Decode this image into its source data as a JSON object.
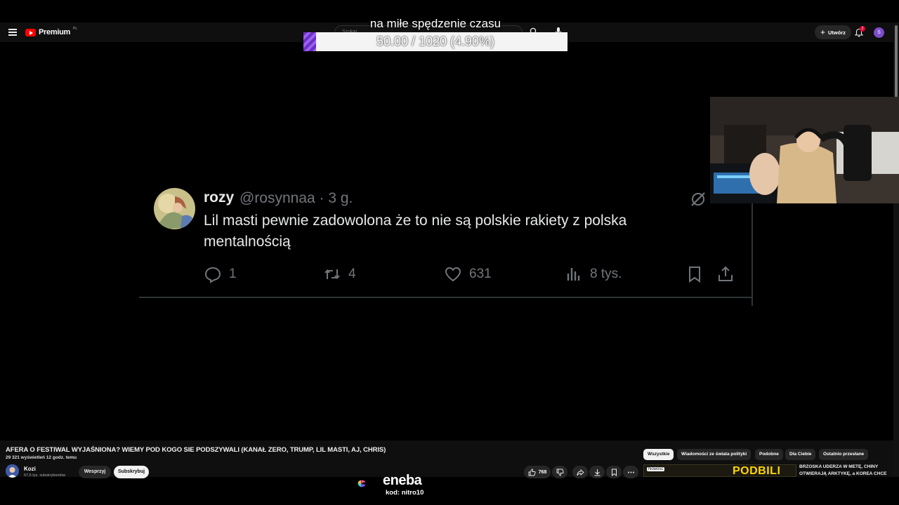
{
  "overlay": {
    "title": "na miłe spędzenie czasu",
    "progress_text": "50.00 / 1020 (4.90%)",
    "progress_fraction": 0.049
  },
  "youtube_header": {
    "logo_text": "Premium",
    "logo_superscript": "PL",
    "search_placeholder": "Szukaj",
    "create_label": "Utwórz",
    "notification_count": "2",
    "avatar_letter": "S",
    "icons": [
      "menu-icon",
      "search-icon",
      "mic-icon",
      "plus-icon",
      "bell-icon"
    ]
  },
  "tweet": {
    "name": "rozy",
    "handle_time": "@rosynnaa · 3 g.",
    "text": "Lil masti pewnie zadowolona że to nie są polskie rakiety z polska mentalnością",
    "replies": "1",
    "retweets": "4",
    "likes": "631",
    "views": "8 tys.",
    "icons": [
      "reply-icon",
      "retweet-icon",
      "like-icon",
      "views-icon",
      "bookmark-icon",
      "share-icon",
      "grok-icon"
    ]
  },
  "video": {
    "title": "AFERA O FESTIWAL WYJAŚNIONA? WIEMY POD KOGO SIE PODSZYWALI (KANAŁ ZERO, TRUMP, LIL MASTI, AJ, CHRIS)",
    "meta": "29 321 wyświetleń  12 godz. temu",
    "channel_name": "Kozi",
    "channel_subs": "57,6 tys. subskrybentów",
    "support_label": "Wesprzyj",
    "subscribe_label": "Subskrybuj",
    "like_count": "768"
  },
  "chips": [
    "Wszystkie",
    "Wiadomości ze świata polityki",
    "Podobne",
    "Dla Ciebie",
    "Ostatnio przesłane"
  ],
  "recommendation": {
    "badge": "Nowość",
    "thumb_text": "PODBILI",
    "title": "BRZOSKA UDERZA W METĘ, CHINY OTWIERAJĄ ARKTYKĘ, a KOREA CHCE"
  },
  "sponsor": {
    "brand": "eneba",
    "code": "kod: nitro10"
  }
}
